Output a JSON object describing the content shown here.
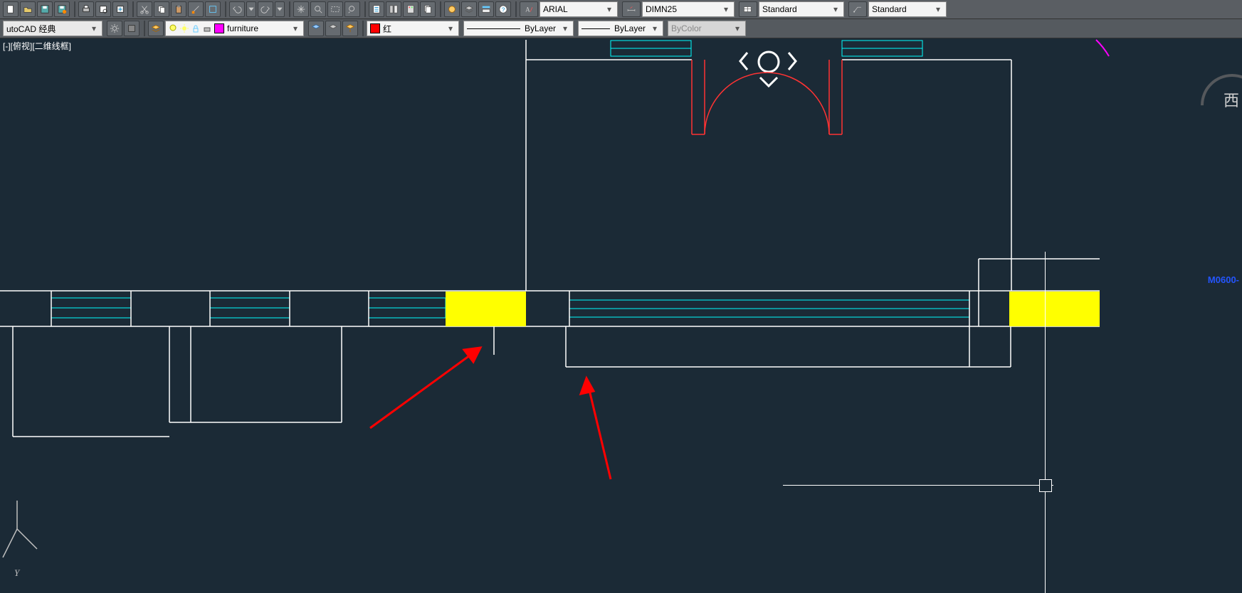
{
  "toolbar": {
    "font": "ARIAL",
    "dimstyle": "DIMN25",
    "tablestyle": "Standard",
    "mleader": "Standard"
  },
  "layerbar": {
    "workspace": "utoCAD 经典",
    "layer_name": "furniture",
    "color_name": "红",
    "linetype": "ByLayer",
    "lineweight": "ByLayer",
    "bycolor": "ByColor"
  },
  "canvas": {
    "viewport_label": "[-][俯视][二维线框]",
    "ucs_y": "Y",
    "west": "西",
    "blue_text": "M0600-"
  }
}
